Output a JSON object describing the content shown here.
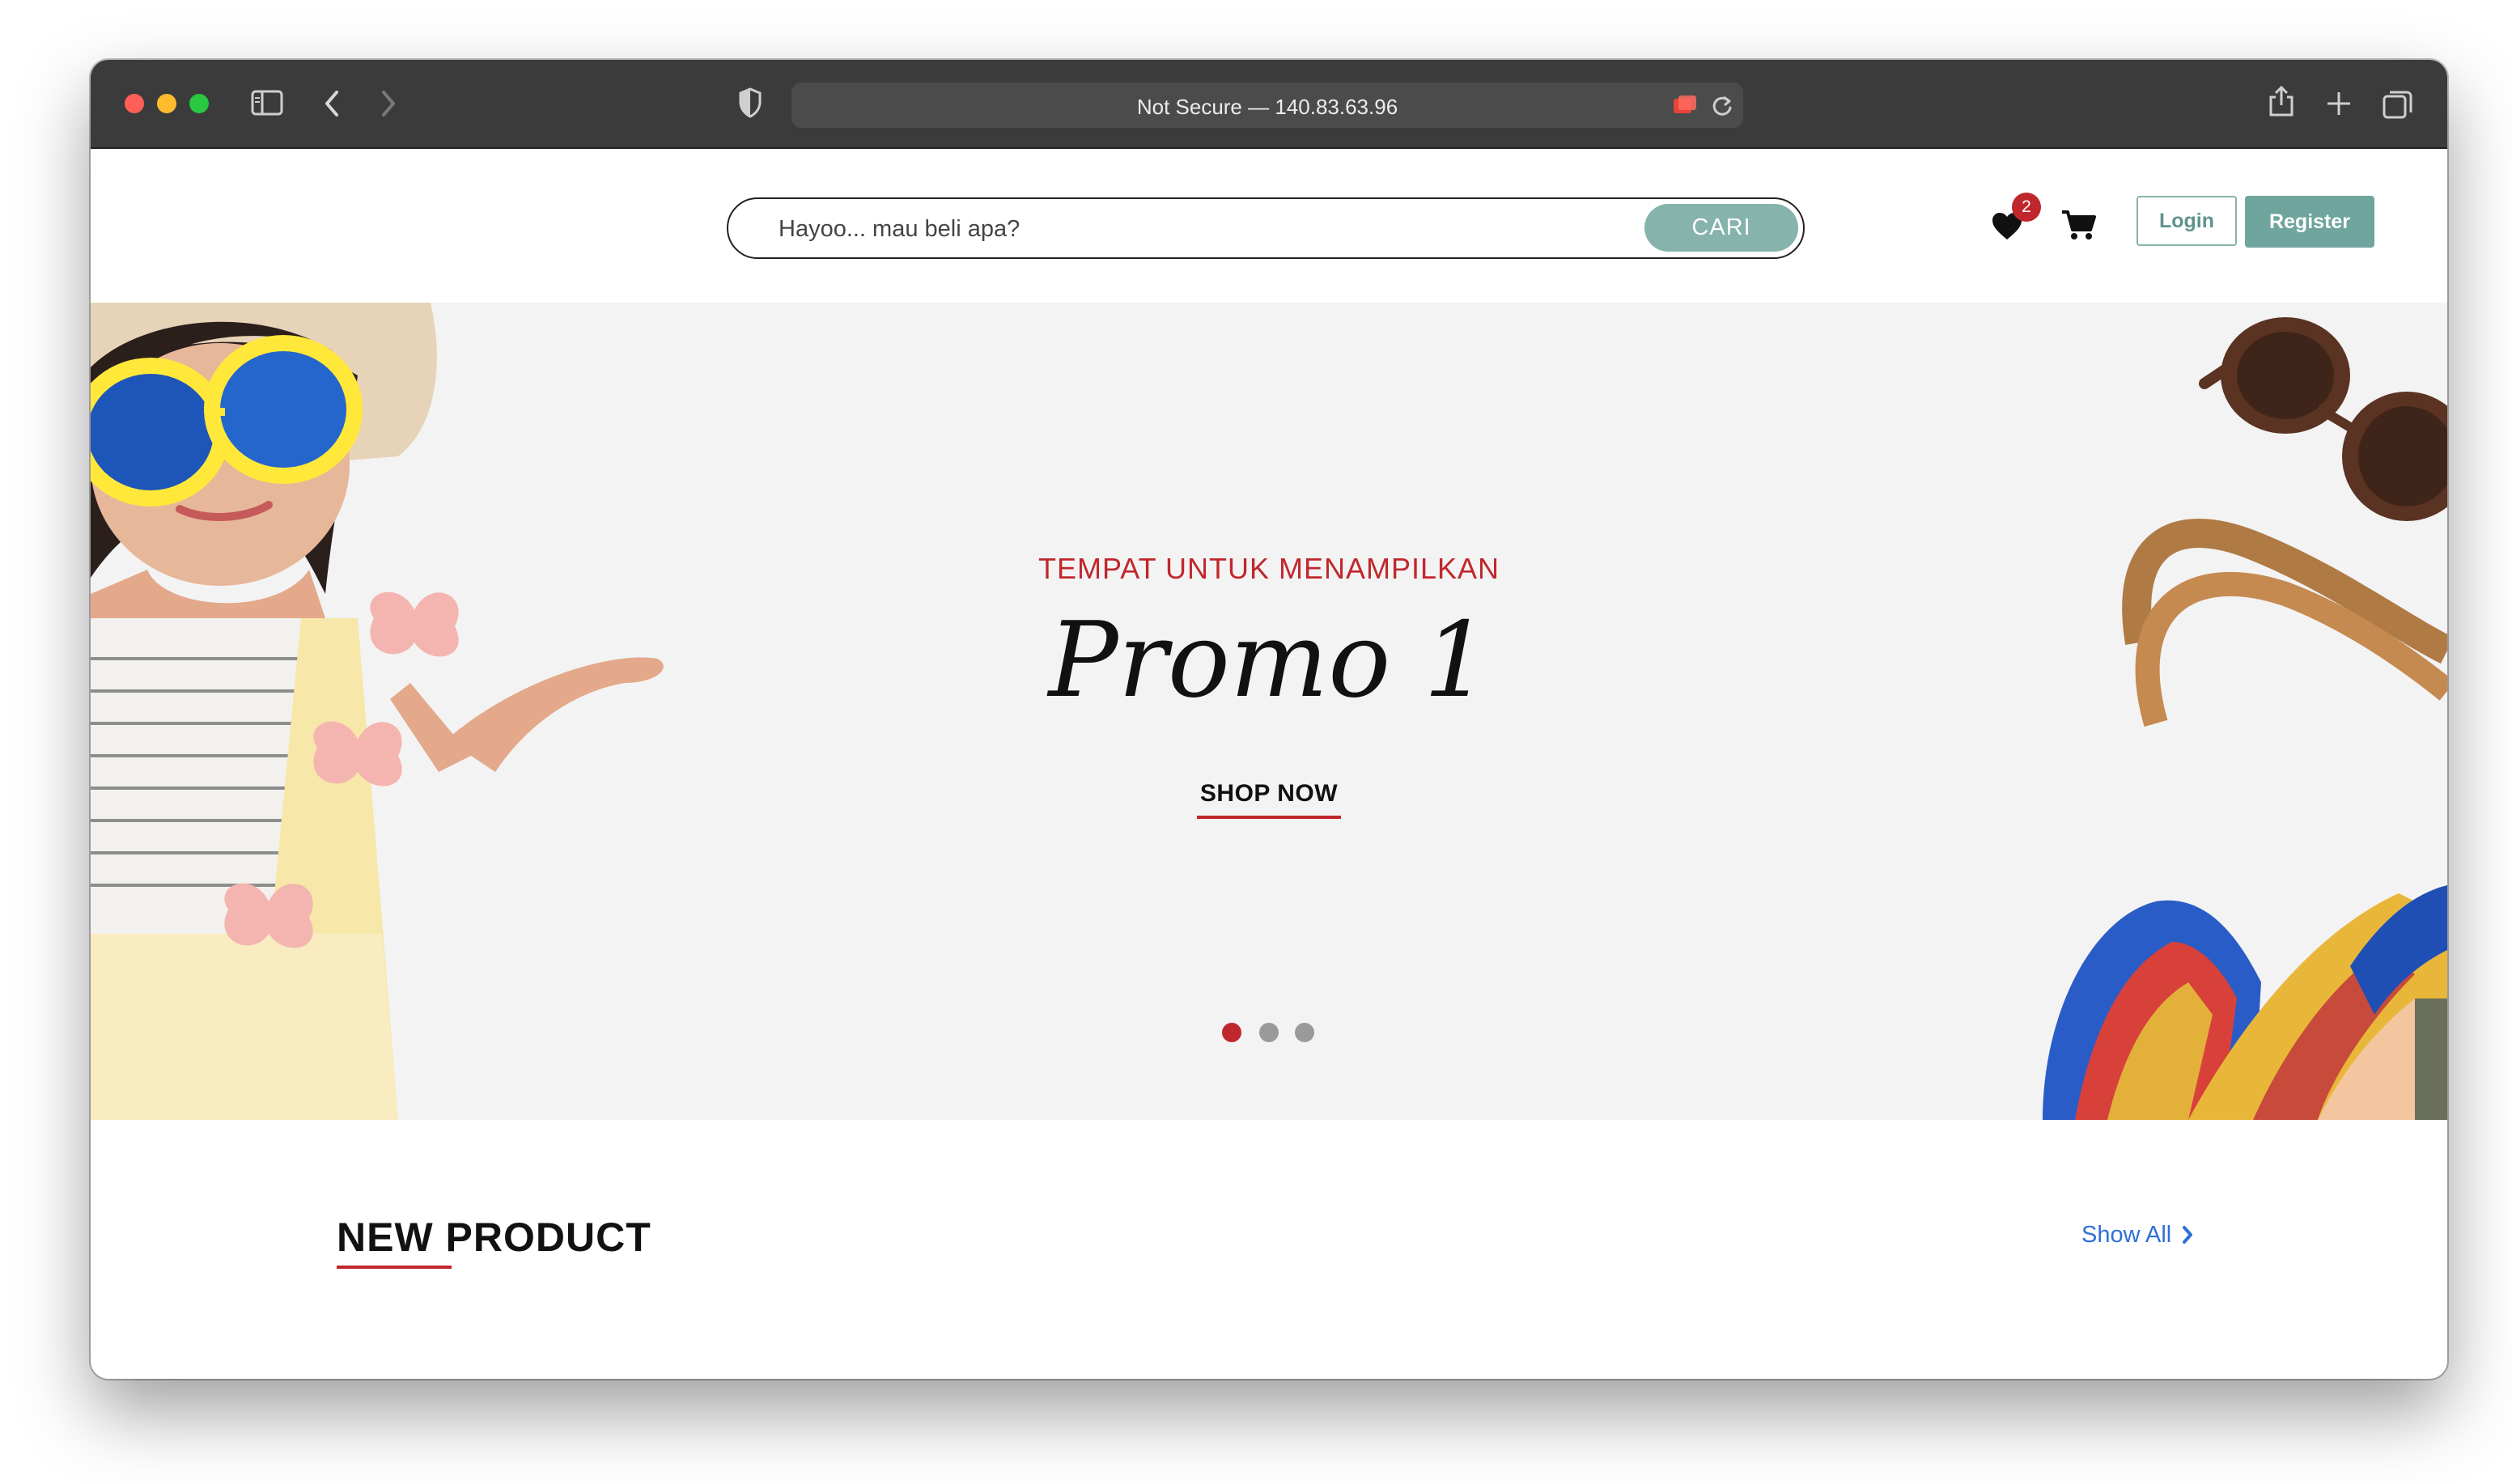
{
  "browser": {
    "address_text": "Not Secure — 140.83.63.96",
    "icons": [
      "sidebar-icon",
      "back-icon",
      "forward-icon",
      "shield-icon",
      "camera-off-icon",
      "reload-icon",
      "share-icon",
      "new-tab-icon",
      "tab-overview-icon"
    ]
  },
  "header": {
    "search_placeholder": "Hayoo... mau beli apa?",
    "search_button": "CARI",
    "wishlist_count": "2",
    "login_label": "Login",
    "register_label": "Register",
    "accent_color": "#86b3ac"
  },
  "hero": {
    "subtitle": "TEMPAT UNTUK MENAMPILKAN",
    "title": "Promo 1",
    "cta": "SHOP NOW",
    "slides": 3,
    "active_slide": 1,
    "accent_color": "#c0272d"
  },
  "new_product": {
    "title": "NEW PRODUCT",
    "show_all": "Show All"
  }
}
